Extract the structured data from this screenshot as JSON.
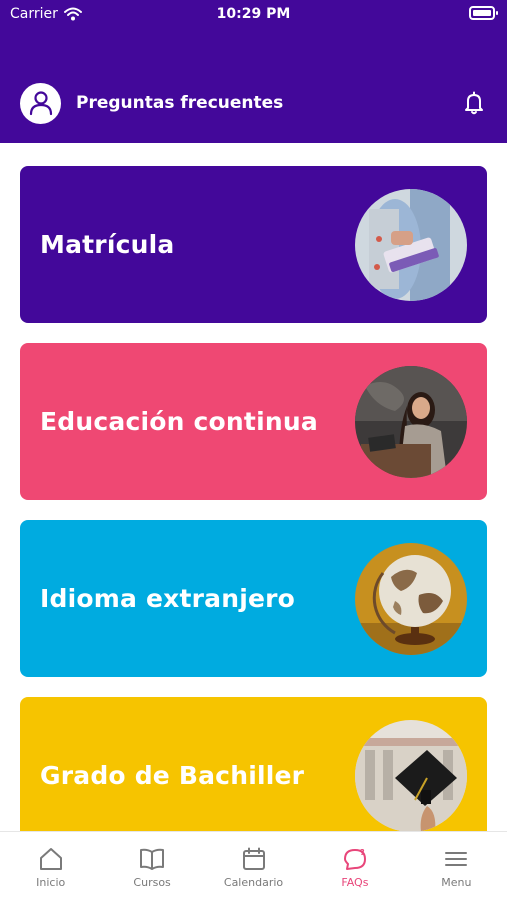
{
  "status_bar": {
    "carrier": "Carrier",
    "time": "10:29 PM"
  },
  "header": {
    "title": "Preguntas frecuentes"
  },
  "cards": [
    {
      "label": "Matrícula",
      "color": "#43089a",
      "image": "student-books-image"
    },
    {
      "label": "Educación continua",
      "color": "#ef4873",
      "image": "woman-laptop-image"
    },
    {
      "label": "Idioma extranjero",
      "color": "#00abe0",
      "image": "globe-image"
    },
    {
      "label": "Grado de Bachiller",
      "color": "#f6c400",
      "image": "graduation-cap-image"
    }
  ],
  "tabs": [
    {
      "label": "Inicio",
      "icon": "home-icon",
      "active": false
    },
    {
      "label": "Cursos",
      "icon": "book-icon",
      "active": false
    },
    {
      "label": "Calendario",
      "icon": "calendar-icon",
      "active": false
    },
    {
      "label": "FAQs",
      "icon": "faq-bubble-icon",
      "active": true
    },
    {
      "label": "Menu",
      "icon": "hamburger-icon",
      "active": false
    }
  ],
  "colors": {
    "header_bg": "#43089a",
    "active_tab": "#e8467a",
    "inactive_tab": "#7a7a7a"
  }
}
